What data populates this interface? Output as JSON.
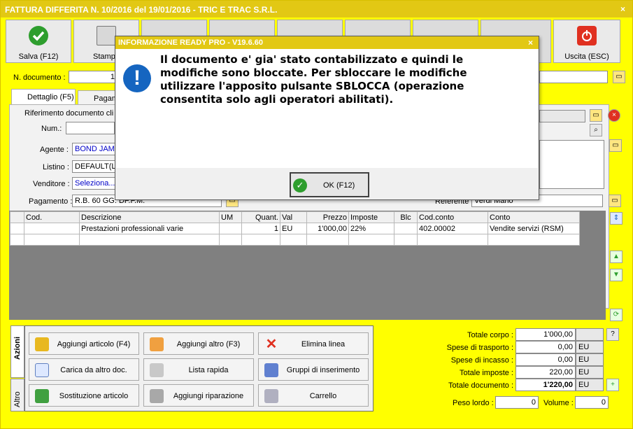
{
  "window": {
    "title": "FATTURA DIFFERITA N. 10/2016 del 19/01/2016 - TRIC E TRAC S.R.L.",
    "close": "×"
  },
  "toolbar": {
    "save": "Salva (F12)",
    "print": "Stampa",
    "exit": "Uscita (ESC)"
  },
  "header": {
    "ndoc_label": "N. documento :",
    "ndoc_value": "1"
  },
  "tabs": {
    "detail": "Dettaglio (F5)",
    "payments": "Pagam"
  },
  "form": {
    "rif_label": "Riferimento documento cli",
    "num_label": "Num.:",
    "agente_label": "Agente :",
    "agente_value": "BOND JAME",
    "listino_label": "Listino :",
    "listino_value": "DEFAULT(Li",
    "venditore_label": "Venditore :",
    "venditore_value": "Seleziona...",
    "pagamento_label": "Pagamento :",
    "pagamento_value": "R.B. 60 GG. DF.F.M.",
    "referente_label": "Referente",
    "referente_value": "Verdi Mario"
  },
  "grid": {
    "columns": [
      "Cod.",
      "Descrizione",
      "UM",
      "Quant.",
      "Val",
      "Prezzo",
      "Imposte",
      "Blc",
      "Cod.conto",
      "Conto"
    ],
    "rows": [
      [
        "",
        "Prestazioni professionali varie",
        "",
        "1",
        "EU",
        "1'000,00",
        "22%",
        "",
        "402.00002",
        "Vendite servizi (RSM)"
      ]
    ]
  },
  "actions": {
    "side_tabs": {
      "azioni": "Azioni",
      "altro": "Altro"
    },
    "add_article": "Aggiungi articolo (F4)",
    "add_other": "Aggiungi altro (F3)",
    "delete_line": "Elimina linea",
    "load_other": "Carica da altro doc.",
    "quick_list": "Lista rapida",
    "insert_groups": "Gruppi di inserimento",
    "replace_article": "Sostituzione articolo",
    "add_repair": "Aggiungi riparazione",
    "cart": "Carrello"
  },
  "totals": {
    "corpo_label": "Totale corpo :",
    "corpo_value": "1'000,00",
    "trasporto_label": "Spese di trasporto :",
    "trasporto_value": "0,00",
    "trasporto_cur": "EU",
    "incasso_label": "Spese di incasso :",
    "incasso_value": "0,00",
    "incasso_cur": "EU",
    "imposte_label": "Totale imposte :",
    "imposte_value": "220,00",
    "imposte_cur": "EU",
    "documento_label": "Totale documento :",
    "documento_value": "1'220,00",
    "documento_cur": "EU",
    "peso_label": "Peso lordo :",
    "peso_value": "0",
    "volume_label": "Volume :",
    "volume_value": "0",
    "help": "?"
  },
  "dialog": {
    "title": "INFORMAZIONE READY PRO - V19.6.60",
    "close": "×",
    "message": "Il documento e' gia' stato contabilizzato e quindi le modifiche sono bloccate. Per sbloccare le modifiche utilizzare l'apposito pulsante SBLOCCA (operazione consentita solo agli operatori abilitati).",
    "icon_glyph": "!",
    "ok": "OK (F12)"
  },
  "colors": {
    "accent": "#ffff00",
    "title": "#e2c814",
    "link": "#0000c8"
  }
}
